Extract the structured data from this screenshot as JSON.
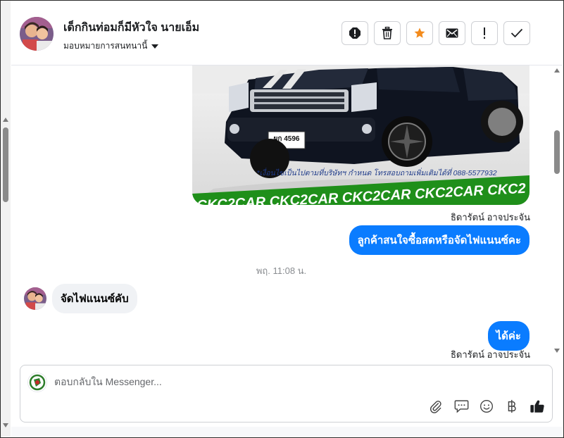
{
  "header": {
    "contact_name": "เด็กกินท่อมก็มีหัวใจ นายเอ็ม",
    "assign_label": "มอบหมายการสนทนานี้",
    "actions": [
      "alert-icon",
      "trash-icon",
      "star-icon",
      "envelope-icon",
      "exclamation-icon",
      "check-icon"
    ]
  },
  "thread": {
    "car_image": {
      "banner_text": "CKC2CAR CKC2CAR CKC2CAR CKC2CAR CKC2",
      "disclaimer": "*เงื่อนไขเป็นไปตามที่บริษัทฯ กำหนด โทรสอบถามเพิ่มเติมได้ที่ 088-5577932",
      "plate": "ผก 4596"
    },
    "messages": [
      {
        "sender": "ธิดารัตน์ อาจประจัน",
        "text": "ลูกค้าสนใจซื้อสดหรือจัดไฟแนนซ์คะ",
        "direction": "out"
      },
      {
        "timestamp": "พฤ. 11:08 น."
      },
      {
        "text": "จัดไฟแนนซ์คับ",
        "direction": "in"
      },
      {
        "text": "ได้ค่ะ",
        "direction": "out",
        "sender": "ธิดารัตน์ อาจประจัน"
      }
    ]
  },
  "composer": {
    "placeholder": "ตอบกลับใน Messenger...",
    "tools": [
      "paperclip-icon",
      "saved-reply-icon",
      "emoji-icon",
      "baht-icon",
      "thumbs-up-icon"
    ]
  },
  "colors": {
    "accent": "#0a7cff",
    "star": "#f38b1c",
    "incoming_bubble": "#f0f2f5",
    "banner_green": "#1f8f1a"
  }
}
